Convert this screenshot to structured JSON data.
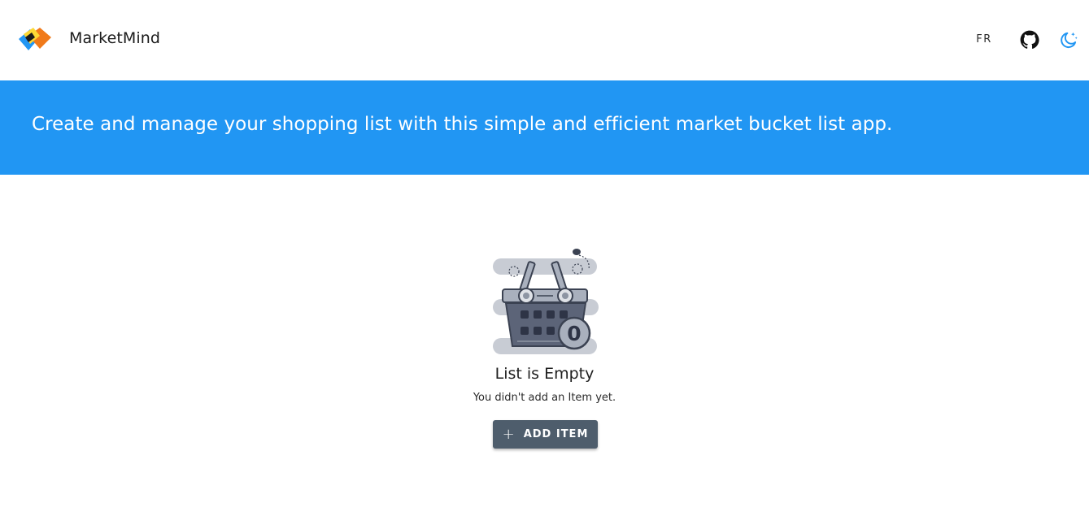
{
  "header": {
    "brand_name": "MarketMind",
    "logo_icon": "basket-logo-icon",
    "lang_label": "FR",
    "github_icon": "github-icon",
    "theme_icon": "moon-icon"
  },
  "banner": {
    "text": "Create and manage your shopping list with this simple and efficient market bucket list app."
  },
  "empty_state": {
    "illustration_icon": "empty-basket-icon",
    "badge_count": "0",
    "title": "List is Empty",
    "subtitle": "You didn't add an Item yet.",
    "button_icon": "plus-icon",
    "button_label": "ADD ITEM"
  },
  "colors": {
    "banner": "#2196f3",
    "button": "#4e5d6c",
    "logo_blue": "#2196f3",
    "logo_orange": "#f07a1a",
    "theme_icon": "#2196f3"
  }
}
